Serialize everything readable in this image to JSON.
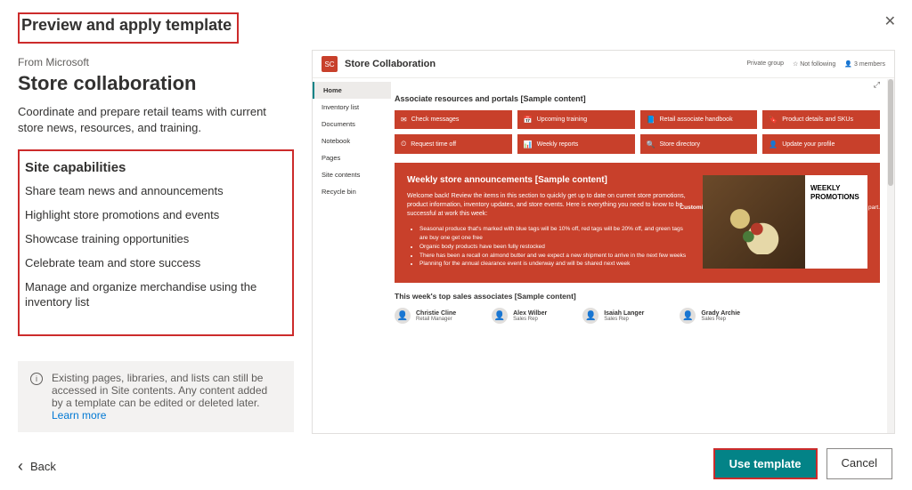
{
  "modal": {
    "title": "Preview and apply template",
    "from": "From Microsoft",
    "template_name": "Store collaboration",
    "description": "Coordinate and prepare retail teams with current store news, resources, and training.",
    "capabilities_heading": "Site capabilities",
    "capabilities": [
      "Share team news and announcements",
      "Highlight store promotions and events",
      "Showcase training opportunities",
      "Celebrate team and store success",
      "Manage and organize merchandise using the inventory list"
    ],
    "info_text": "Existing pages, libraries, and lists can still be accessed in Site contents. Any content added by a template can be edited or deleted later. ",
    "info_link": "Learn more",
    "back_label": "Back",
    "use_label": "Use template",
    "cancel_label": "Cancel"
  },
  "preview": {
    "logo_text": "SC",
    "site_title": "Store Collaboration",
    "meta": {
      "group": "Private group",
      "follow": "Not following",
      "members": "3 members"
    },
    "nav": [
      "Home",
      "Inventory list",
      "Documents",
      "Notebook",
      "Pages",
      "Site contents",
      "Recycle bin"
    ],
    "section_resources": "Associate resources and portals [Sample content]",
    "tiles": [
      {
        "icon": "✉",
        "label": "Check messages"
      },
      {
        "icon": "📅",
        "label": "Upcoming training"
      },
      {
        "icon": "📘",
        "label": "Retail associate handbook"
      },
      {
        "icon": "🔖",
        "label": "Product details and SKUs"
      },
      {
        "icon": "⏲",
        "label": "Request time off"
      },
      {
        "icon": "📊",
        "label": "Weekly reports"
      },
      {
        "icon": "🔍",
        "label": "Store directory"
      },
      {
        "icon": "👤",
        "label": "Update your profile"
      }
    ],
    "banner": {
      "title": "Weekly store announcements [Sample content]",
      "guidance_label": "Customization guidance:",
      "guidance_text": "Replace this graphic with the File Viewer web part.",
      "intro": "Welcome back! Review the items in this section to quickly get up to date on current store promotions, product information, inventory updates, and store events. Here is everything you need to know to be successful at work this week:",
      "bullets": [
        "Seasonal produce that's marked with blue tags will be 10% off, red tags will be 20% off, and green tags are buy one get one free",
        "Organic body products have been fully restocked",
        "There has been a recall on almond butter and we expect a new shipment to arrive in the next few weeks",
        "Planning for the annual clearance event is underway and will be shared next week"
      ],
      "promo_text": "WEEKLY PROMOTIONS"
    },
    "associates": {
      "title": "This week's top sales associates [Sample content]",
      "people": [
        {
          "name": "Christie Cline",
          "role": "Retail Manager"
        },
        {
          "name": "Alex Wilber",
          "role": "Sales Rep"
        },
        {
          "name": "Isaiah Langer",
          "role": "Sales Rep"
        },
        {
          "name": "Grady Archie",
          "role": "Sales Rep"
        }
      ]
    }
  }
}
